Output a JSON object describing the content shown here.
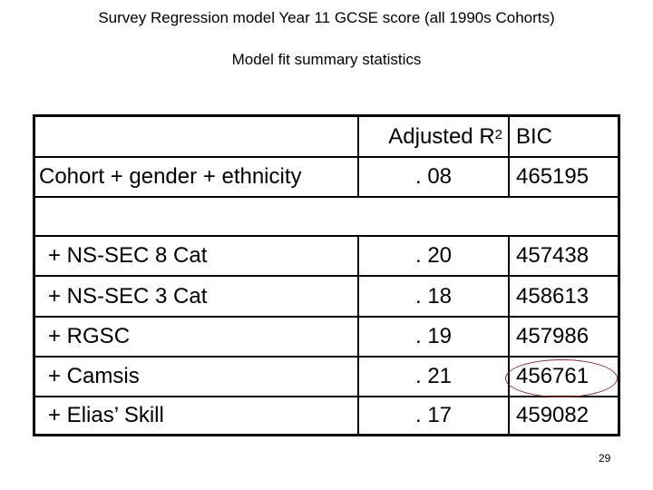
{
  "title": "Survey Regression model Year 11 GCSE score (all 1990s Cohorts)",
  "subtitle": "Model fit summary statistics",
  "table": {
    "headers": {
      "model": "",
      "adjusted_r2": "Adjusted R",
      "adjusted_r2_sup": "2",
      "bic": "BIC"
    },
    "base_row": {
      "model": "Cohort + gender + ethnicity",
      "adjusted_r2": ". 08",
      "bic": "465195"
    },
    "rows": [
      {
        "model": "+ NS-SEC 8 Cat",
        "adjusted_r2": ". 20",
        "bic": "457438"
      },
      {
        "model": "+ NS-SEC 3 Cat",
        "adjusted_r2": ". 18",
        "bic": "458613"
      },
      {
        "model": "+ RGSC",
        "adjusted_r2": ". 19",
        "bic": "457986"
      },
      {
        "model": "+ Camsis",
        "adjusted_r2": ". 21",
        "bic": "456761",
        "highlighted": true
      },
      {
        "model": "+ Elias’ Skill",
        "adjusted_r2": ". 17",
        "bic": "459082"
      }
    ]
  },
  "highlight_color": "#9b2a2a",
  "page_number": "29"
}
